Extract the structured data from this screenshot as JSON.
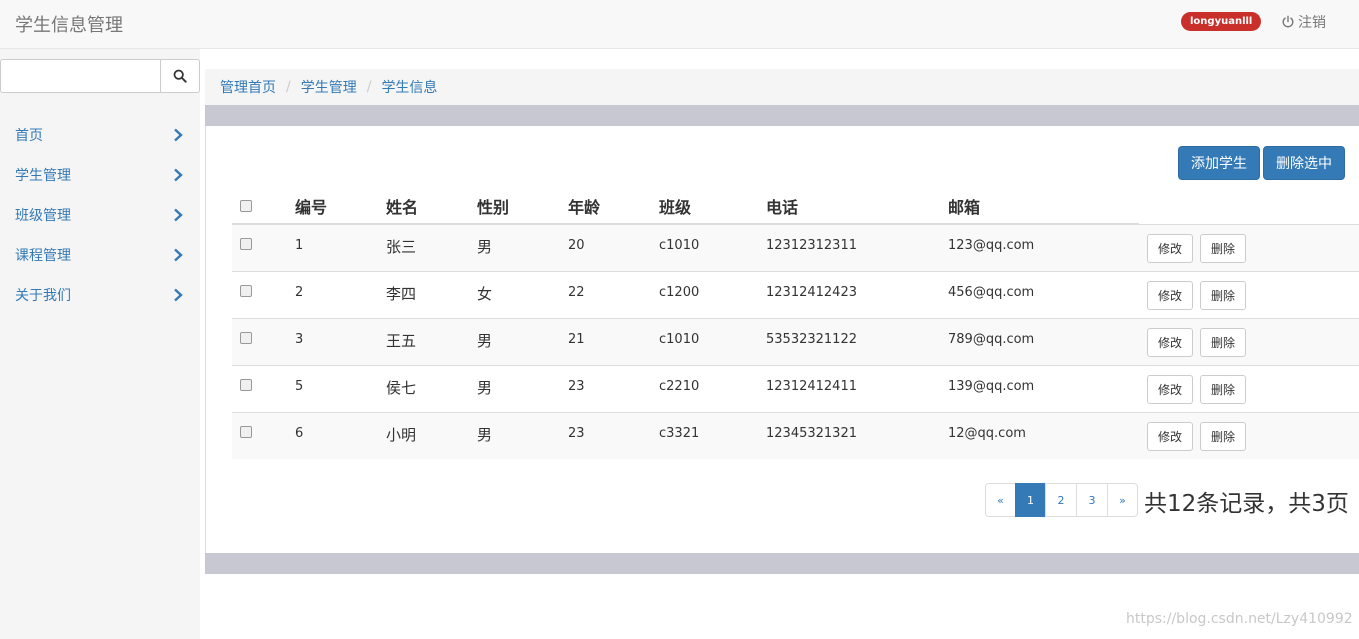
{
  "header": {
    "title": "学生信息管理",
    "user": "longyuanlll",
    "logout_label": "注销"
  },
  "sidebar": {
    "search": {
      "value": "",
      "placeholder": ""
    },
    "items": [
      {
        "label": "首页"
      },
      {
        "label": "学生管理"
      },
      {
        "label": "班级管理"
      },
      {
        "label": "课程管理"
      },
      {
        "label": "关于我们"
      }
    ]
  },
  "breadcrumb": [
    "管理首页",
    "学生管理",
    "学生信息"
  ],
  "toolbar": {
    "add_label": "添加学生",
    "delete_selected_label": "删除选中"
  },
  "table": {
    "columns": [
      "编号",
      "姓名",
      "性别",
      "年龄",
      "班级",
      "电话",
      "邮箱"
    ],
    "rows": [
      {
        "id": "1",
        "name": "张三",
        "gender": "男",
        "age": "20",
        "class": "c1010",
        "phone": "12312312311",
        "email": "123@qq.com"
      },
      {
        "id": "2",
        "name": "李四",
        "gender": "女",
        "age": "22",
        "class": "c1200",
        "phone": "12312412423",
        "email": "456@qq.com"
      },
      {
        "id": "3",
        "name": "王五",
        "gender": "男",
        "age": "21",
        "class": "c1010",
        "phone": "53532321122",
        "email": "789@qq.com"
      },
      {
        "id": "5",
        "name": "侯七",
        "gender": "男",
        "age": "23",
        "class": "c2210",
        "phone": "12312412411",
        "email": "139@qq.com"
      },
      {
        "id": "6",
        "name": "小明",
        "gender": "男",
        "age": "23",
        "class": "c3321",
        "phone": "12345321321",
        "email": "12@qq.com"
      }
    ],
    "edit_label": "修改",
    "delete_label": "删除"
  },
  "pagination": {
    "prev": "«",
    "pages": [
      "1",
      "2",
      "3"
    ],
    "current": "1",
    "next": "»",
    "info": "共12条记录，共3页"
  },
  "watermark": "https://blog.csdn.net/Lzy410992",
  "colors": {
    "primary": "#337ab7",
    "danger_badge": "#c9302c"
  }
}
